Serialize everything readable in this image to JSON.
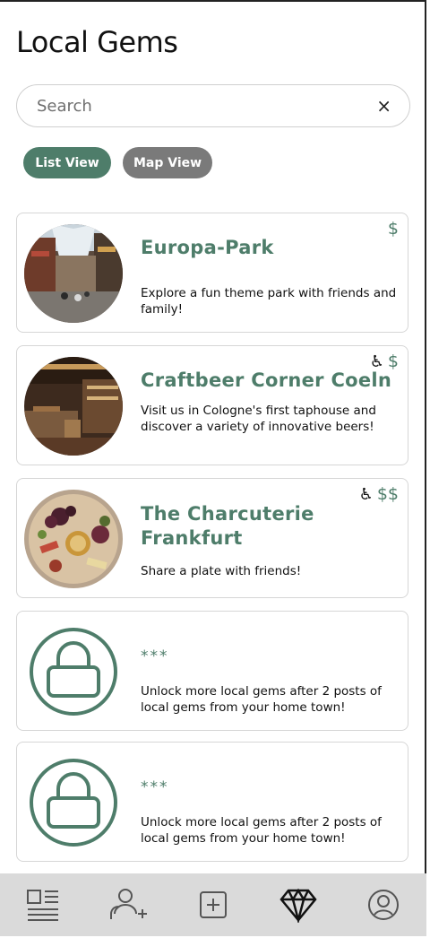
{
  "app": {
    "title": "Local Gems"
  },
  "search": {
    "placeholder": "Search",
    "value": ""
  },
  "view_toggle": {
    "list_label": "List View",
    "map_label": "Map View",
    "active": "List View"
  },
  "cards": [
    {
      "title_line1": "Europa-Park",
      "title_line2": "",
      "description": "Explore a fun theme park with friends and family!",
      "price": "$",
      "accessible": false,
      "image": "theme-park-street-photo"
    },
    {
      "title_line1": "Craftbeer Corner Coeln",
      "title_line2": "",
      "description": "Visit us in Cologne's first taphouse and discover a variety of innovative beers!",
      "price": "$",
      "accessible": true,
      "image": "taphouse-interior-photo"
    },
    {
      "title_line1": "The Charcuterie",
      "title_line2": "Frankfurt",
      "description": "Share a plate with friends!",
      "price": "$$",
      "accessible": true,
      "image": "charcuterie-board-photo"
    }
  ],
  "locked_cards": [
    {
      "title": "***",
      "description": "Unlock more local gems after 2 posts of local gems from your home town!"
    },
    {
      "title": "***",
      "description": "Unlock more local gems after 2 posts of local gems from your home town!"
    }
  ],
  "icons": {
    "clear": "×",
    "wheelchair": "♿"
  },
  "colors": {
    "accent": "#4e7d6a",
    "inactive_toggle": "#7a7a7a",
    "nav_bar": "#dadada"
  },
  "bottom_nav": [
    "feed-icon",
    "add-friend-icon",
    "add-post-icon",
    "gem-icon",
    "profile-icon"
  ]
}
